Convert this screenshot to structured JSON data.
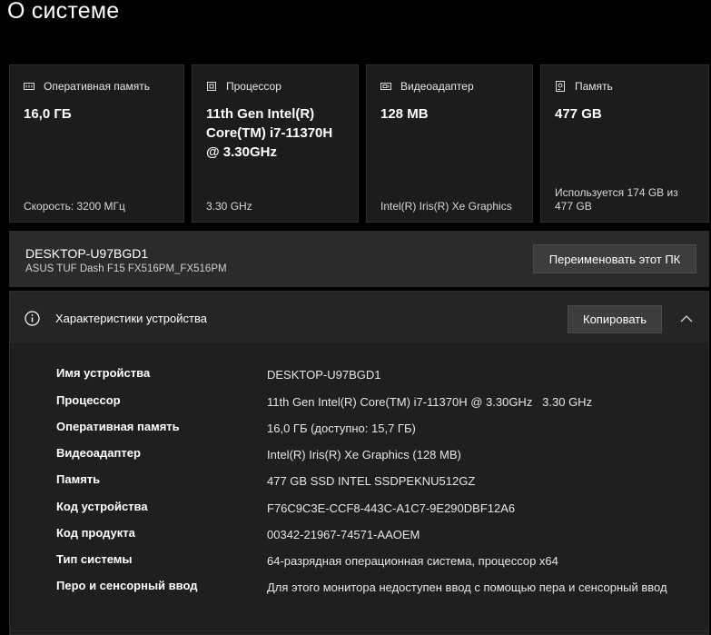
{
  "page": {
    "title": "О системе"
  },
  "cards": [
    {
      "icon": "memory-icon",
      "label": "Оперативная память",
      "value": "16,0 ГБ",
      "footer": "Скорость: 3200 МГц"
    },
    {
      "icon": "processor-icon",
      "label": "Процессор",
      "value": "11th Gen Intel(R) Core(TM) i7-11370H @ 3.30GHz",
      "footer": "3.30 GHz"
    },
    {
      "icon": "display-adapter-icon",
      "label": "Видеоадаптер",
      "value": "128 MB",
      "footer": "Intel(R) Iris(R) Xe Graphics"
    },
    {
      "icon": "storage-icon",
      "label": "Память",
      "value": "477 GB",
      "footer": "Используется 174 GB из 477 GB"
    }
  ],
  "pc": {
    "name": "DESKTOP-U97BGD1",
    "model": "ASUS TUF Dash F15 FX516PM_FX516PM",
    "rename_label": "Переименовать этот ПК"
  },
  "specs": {
    "title": "Характеристики устройства",
    "copy_label": "Копировать",
    "rows": [
      {
        "label": "Имя устройства",
        "value": "DESKTOP-U97BGD1"
      },
      {
        "label": "Процессор",
        "value": "11th Gen Intel(R) Core(TM) i7-11370H @ 3.30GHz   3.30 GHz"
      },
      {
        "label": "Оперативная память",
        "value": "16,0 ГБ (доступно: 15,7 ГБ)"
      },
      {
        "label": "Видеоадаптер",
        "value": "Intel(R) Iris(R) Xe Graphics (128 MB)"
      },
      {
        "label": "Память",
        "value": "477 GB SSD INTEL SSDPEKNU512GZ"
      },
      {
        "label": "Код устройства",
        "value": "F76C9C3E-CCF8-443C-A1C7-9E290DBF12A6"
      },
      {
        "label": "Код продукта",
        "value": "00342-21967-74571-AAOEM"
      },
      {
        "label": "Тип системы",
        "value": "64-разрядная операционная система, процессор x64"
      },
      {
        "label": "Перо и сенсорный ввод",
        "value": "Для этого монитора недоступен ввод с помощью пера и сенсорный ввод"
      }
    ]
  },
  "colors": {
    "background": "#000000",
    "card": "#1c1c1c",
    "bar": "#2b2b2b",
    "button": "#3d3d3d",
    "text": "#ffffff"
  }
}
